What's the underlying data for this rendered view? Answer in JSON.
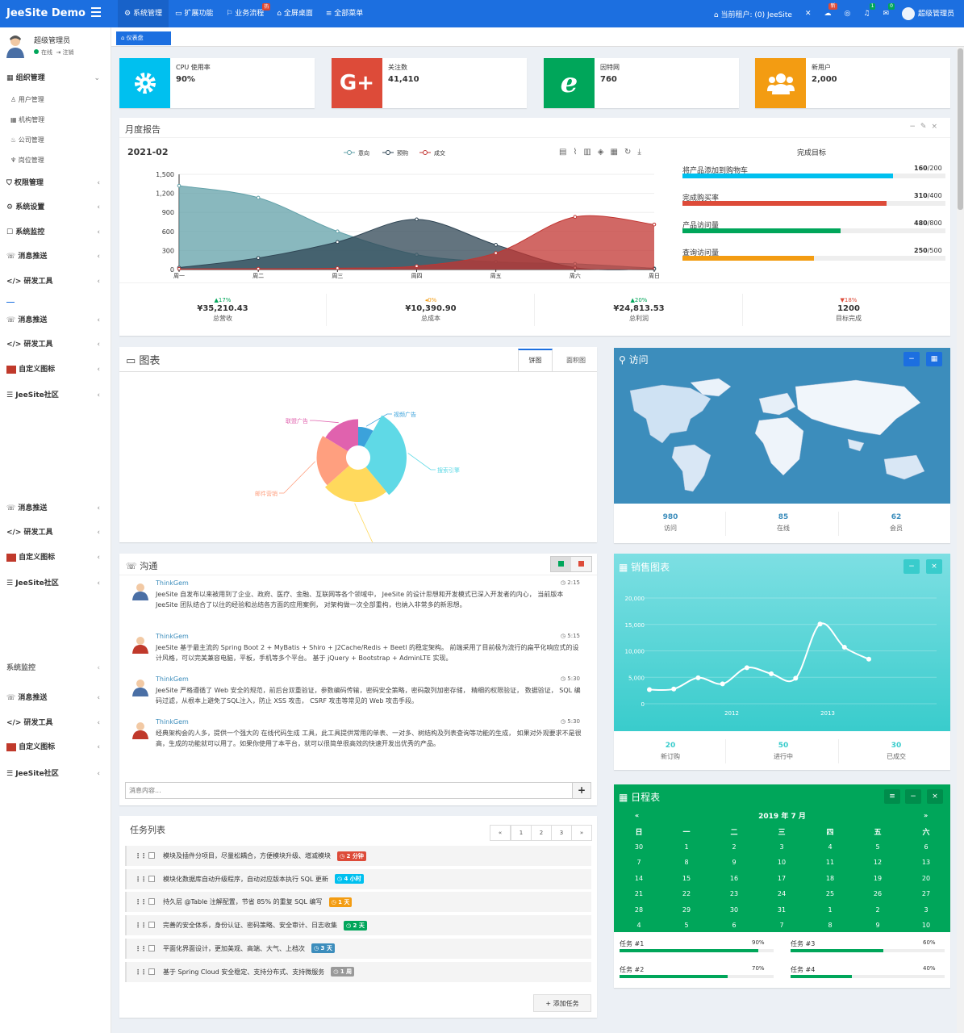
{
  "app": {
    "logo": "JeeSite Demo"
  },
  "topnav": [
    {
      "label": "系统管理"
    },
    {
      "label": "扩展功能"
    },
    {
      "label": "业务流程"
    },
    {
      "label": "全屏桌面"
    },
    {
      "label": "全部菜单"
    }
  ],
  "topnav_hot_badge": "热",
  "topright": {
    "tenant": "当前租户: (0) JeeSite",
    "new_badge": "新",
    "notif_count": "1",
    "mail_count": "0",
    "user": "超级管理员"
  },
  "user": {
    "name": "超级管理员",
    "status": "在线",
    "logout": "注销"
  },
  "sidebar": {
    "groups": [
      {
        "label": "组织管理"
      },
      {
        "label": "权限管理"
      },
      {
        "label": "系统设置"
      },
      {
        "label": "系统监控"
      },
      {
        "label": "消息推送"
      },
      {
        "label": "研发工具"
      },
      {
        "label": "消息推送"
      },
      {
        "label": "研发工具"
      },
      {
        "label": "自定义图标"
      },
      {
        "label": "JeeSite社区"
      },
      {
        "label": "消息推送"
      },
      {
        "label": "研发工具"
      },
      {
        "label": "自定义图标"
      },
      {
        "label": "JeeSite社区"
      },
      {
        "label": "系统监控"
      },
      {
        "label": "消息推送"
      },
      {
        "label": "研发工具"
      },
      {
        "label": "自定义图标"
      },
      {
        "label": "JeeSite社区"
      }
    ],
    "subs": [
      {
        "label": "用户管理"
      },
      {
        "label": "机构管理"
      },
      {
        "label": "公司管理"
      },
      {
        "label": "岗位管理"
      }
    ]
  },
  "tab": {
    "label": "仪表盘"
  },
  "infoboxes": [
    {
      "label": "CPU 使用率",
      "value": "90%",
      "color": "#00c0ef",
      "icon": "gear-icon"
    },
    {
      "label": "关注数",
      "value": "41,410",
      "color": "#dd4b39",
      "icon": "google-plus-icon"
    },
    {
      "label": "因特网",
      "value": "760",
      "color": "#00a65a",
      "icon": "ie-icon"
    },
    {
      "label": "新用户",
      "value": "2,000",
      "color": "#f39c12",
      "icon": "users-icon"
    }
  ],
  "monthly": {
    "title": "月度报告",
    "period": "2021-02",
    "goals_title": "完成目标",
    "goals": [
      {
        "label": "将产品添加到购物车",
        "value": "160",
        "total": "/200",
        "ratio": 0.8,
        "color": "#00c0ef"
      },
      {
        "label": "完成购买率",
        "value": "310",
        "total": "/400",
        "ratio": 0.775,
        "color": "#dd4b39"
      },
      {
        "label": "产品访问量",
        "value": "480",
        "total": "/800",
        "ratio": 0.6,
        "color": "#00a65a"
      },
      {
        "label": "查询访问量",
        "value": "250",
        "total": "/500",
        "ratio": 0.5,
        "color": "#f39c12"
      }
    ],
    "kpis": [
      {
        "pct": "▲17%",
        "amount": "¥35,210.43",
        "caption": "总营收",
        "color": "#00a65a"
      },
      {
        "pct": "◂0%",
        "amount": "¥10,390.90",
        "caption": "总成本",
        "color": "#f39c12"
      },
      {
        "pct": "▲20%",
        "amount": "¥24,813.53",
        "caption": "总利润",
        "color": "#00a65a"
      },
      {
        "pct": "▼18%",
        "amount": "1200",
        "caption": "目标完成",
        "color": "#dd4b39"
      }
    ]
  },
  "chart_data": [
    {
      "type": "area",
      "title": "2021-02",
      "categories": [
        "周一",
        "周二",
        "周三",
        "周四",
        "周五",
        "周六",
        "周日"
      ],
      "ylim": [
        0,
        1500
      ],
      "yticks": [
        "0",
        "300",
        "600",
        "900",
        "1,200",
        "1,500"
      ],
      "legend_position": "top-center",
      "series": [
        {
          "name": "意向",
          "values": [
            1320,
            1132,
            601,
            234,
            120,
            90,
            20
          ],
          "color": "#61a0a8"
        },
        {
          "name": "预购",
          "values": [
            30,
            182,
            434,
            791,
            390,
            30,
            10
          ],
          "color": "#2f4554"
        },
        {
          "name": "成交",
          "values": [
            10,
            12,
            21,
            54,
            260,
            830,
            710
          ],
          "color": "#c23531"
        }
      ]
    },
    {
      "type": "pie",
      "title": "图表",
      "tabs": [
        "饼图",
        "面积图"
      ],
      "slices": [
        {
          "name": "视频广告",
          "value": 10,
          "color": "#3ba2db"
        },
        {
          "name": "搜索引擎",
          "value": 38,
          "color": "#5fd9e6"
        },
        {
          "name": "直接访问",
          "value": 30,
          "color": "#ffd95c"
        },
        {
          "name": "邮件营销",
          "value": 25,
          "color": "#ff9f7f"
        },
        {
          "name": "联盟广告",
          "value": 20,
          "color": "#e062ae"
        }
      ]
    },
    {
      "type": "line",
      "title": "销售图表",
      "x_labels": [
        "2012",
        "2013"
      ],
      "ylim": [
        0,
        20000
      ],
      "yticks": [
        "0",
        "5,000",
        "10,000",
        "15,000",
        "20,000"
      ],
      "series": [
        {
          "name": "",
          "values": [
            2666,
            2778,
            4912,
            3767,
            6810,
            5670,
            4820,
            15073,
            10687,
            8432
          ]
        }
      ]
    }
  ],
  "visits": {
    "title": "访问",
    "stats": [
      {
        "value": "980",
        "label": "访问"
      },
      {
        "value": "85",
        "label": "在线"
      },
      {
        "value": "62",
        "label": "会员"
      }
    ]
  },
  "sales": {
    "stats": [
      {
        "value": "20",
        "label": "新订购"
      },
      {
        "value": "50",
        "label": "进行中"
      },
      {
        "value": "30",
        "label": "已成交"
      }
    ]
  },
  "chat": {
    "title": "沟通",
    "placeholder": "消息内容...",
    "messages": [
      {
        "name": "ThinkGem",
        "time": "2:15",
        "text": "JeeSite 自发布以来被用到了企业、政府、医疗、金融、互联网等各个领域中， JeeSite 的设计思想和开发模式已深入开发者的内心， 当前版本 JeeSite 团队结合了以往的经验和总结各方面的应用案例， 对架构做一次全部重构，也纳入非常多的新思想。"
      },
      {
        "name": "ThinkGem",
        "time": "5:15",
        "text": "JeeSite 基于最主流的 Spring Boot 2 + MyBatis + Shiro + J2Cache/Redis + Beetl 的稳定架构。 前端采用了目前极为流行的扁平化响应式的设计风格，可以完美兼容电脑，平板，手机等多个平台。 基于 jQuery + Bootstrap + AdminLTE 实现。"
      },
      {
        "name": "ThinkGem",
        "time": "5:30",
        "text": "JeeSite 严格遵循了 Web 安全的规范，前后台双重验证，参数编码传输，密码安全策略，密码散列加密存储， 精细的权限验证， 数据验证， SQL 编码过滤，从根本上避免了SQL注入，防止 XSS 攻击， CSRF 攻击等常见的 Web 攻击手段。"
      },
      {
        "name": "ThinkGem",
        "time": "5:30",
        "text": "经典架构会的人多，提供一个强大的 在线代码生成 工具，此工具提供常用的单表、一对多、树结构及列表查询等功能的生成， 如果对外观要求不是很高，生成的功能就可以用了。如果你使用了本平台，就可以很简单很高效的快速开发出优秀的产品。"
      }
    ]
  },
  "tasks": {
    "title": "任务列表",
    "pager": [
      "«",
      "1",
      "2",
      "3",
      "»"
    ],
    "add_label": "添加任务",
    "items": [
      {
        "text": "模块及插件分项目，尽量松耦合，方便模块升级、增减模块",
        "label": "2 分钟",
        "color": "#dd4b39"
      },
      {
        "text": "模块化数据库自动升级程序，自动对应版本执行 SQL 更新",
        "label": "4 小时",
        "color": "#00c0ef"
      },
      {
        "text": "持久层 @Table 注解配置，节省 85% 的重复 SQL 编写",
        "label": "1 天",
        "color": "#f39c12"
      },
      {
        "text": "完善的安全体系，身份认证、密码策略、安全审计、日志收集",
        "label": "2 天",
        "color": "#00a65a"
      },
      {
        "text": "平面化界面设计，更加美观、高端、大气、上档次",
        "label": "3 天",
        "color": "#3c8dbc"
      },
      {
        "text": "基于 Spring Cloud 安全稳定、支持分布式、支持微服务",
        "label": "1 周",
        "color": "#999999"
      }
    ]
  },
  "calendar": {
    "title": "日程表",
    "month": "2019 年 7 月",
    "prev": "«",
    "next": "»",
    "weekdays": [
      "日",
      "一",
      "二",
      "三",
      "四",
      "五",
      "六"
    ],
    "weeks": [
      [
        "30",
        "1",
        "2",
        "3",
        "4",
        "5",
        "6"
      ],
      [
        "7",
        "8",
        "9",
        "10",
        "11",
        "12",
        "13"
      ],
      [
        "14",
        "15",
        "16",
        "17",
        "18",
        "19",
        "20"
      ],
      [
        "21",
        "22",
        "23",
        "24",
        "25",
        "26",
        "27"
      ],
      [
        "28",
        "29",
        "30",
        "31",
        "1",
        "2",
        "3"
      ],
      [
        "4",
        "5",
        "6",
        "7",
        "8",
        "9",
        "10"
      ]
    ],
    "tasks": [
      {
        "label": "任务 #1",
        "pct": "90%",
        "ratio": 0.9
      },
      {
        "label": "任务 #3",
        "pct": "60%",
        "ratio": 0.6
      },
      {
        "label": "任务 #2",
        "pct": "70%",
        "ratio": 0.7
      },
      {
        "label": "任务 #4",
        "pct": "40%",
        "ratio": 0.4
      }
    ]
  }
}
